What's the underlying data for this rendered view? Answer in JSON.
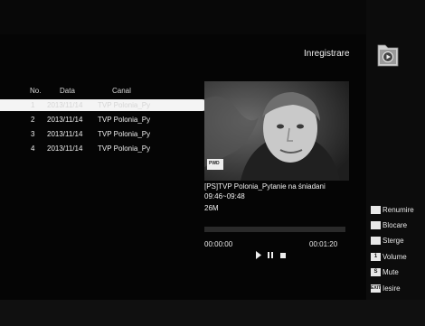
{
  "header": {
    "title": "Inregistrare",
    "icon": "folder-play-icon"
  },
  "list": {
    "columns": {
      "no": "No.",
      "date": "Data",
      "channel": "Canal"
    },
    "rows": [
      {
        "no": "1",
        "date": "2013/11/14",
        "channel": "TVP Polonia_Py",
        "selected": true
      },
      {
        "no": "2",
        "date": "2013/11/14",
        "channel": "TVP Polonia_Py",
        "selected": false
      },
      {
        "no": "3",
        "date": "2013/11/14",
        "channel": "TVP Polonia_Py",
        "selected": false
      },
      {
        "no": "4",
        "date": "2013/11/14",
        "channel": "TVP Polonia_Py",
        "selected": false
      }
    ]
  },
  "preview": {
    "logo": "PWD"
  },
  "details": {
    "name": "[PS]TVP Polonia_Pytanie na śniadani",
    "time_range": "09:46~09:48",
    "size": "26M"
  },
  "playback": {
    "elapsed": "00:00:00",
    "total": "00:01:20",
    "progress_fraction": 0.0,
    "controls": [
      "play",
      "pause",
      "stop"
    ]
  },
  "keys": [
    {
      "key_label": "",
      "label": "Renumire",
      "icon": "color-key-icon"
    },
    {
      "key_label": "",
      "label": "Blocare",
      "icon": "color-key-icon"
    },
    {
      "key_label": "",
      "label": "Sterge",
      "icon": "color-key-icon"
    },
    {
      "key_label": "1",
      "label": "Volume",
      "icon": "number-key-icon"
    },
    {
      "key_label": "S",
      "label": "Mute",
      "icon": "mute-key-icon"
    },
    {
      "key_label": "EXIT",
      "label": "Iesire",
      "icon": "exit-key-icon"
    }
  ],
  "colors": {
    "background": "#050505",
    "highlight": "#f4f4f4",
    "text": "#e8e8e8"
  }
}
